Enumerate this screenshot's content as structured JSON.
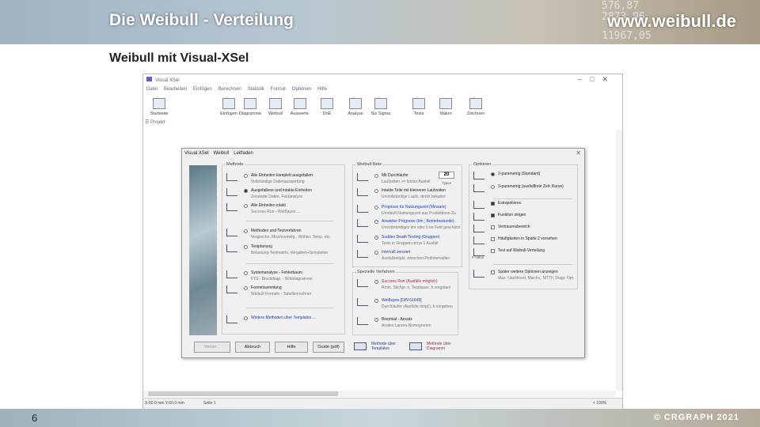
{
  "slide": {
    "title": "Die Weibull - Verteilung",
    "url": "www.weibull.de",
    "bg_numbers": [
      "576,87",
      "2873,96",
      "11967,05"
    ],
    "subtitle": "Weibull mit Visual-XSel",
    "page_number": "6",
    "copyright": "© CRGRAPH 2021"
  },
  "app": {
    "title": "Visual XSel",
    "menu": [
      "Datei",
      "Bearbeiten",
      "Einfügen",
      "Berechnen",
      "Statistik",
      "Format",
      "Optionen",
      "Hilfe"
    ],
    "toolbar": [
      "Startseite",
      "Einfügen",
      "Diagramme",
      "Weibull",
      "Auswerte.",
      "DoE",
      "Analyse",
      "Six Sigma",
      "Tests",
      "Makro",
      "Zeichnen"
    ],
    "project_label": "Projekt",
    "status": {
      "coords": "X-60.0 mm  Y-60.0 mm",
      "sheet": "Seite 1",
      "zoom": "+ 100%"
    }
  },
  "dialog": {
    "menu": [
      "Visual XSel",
      "Weibull",
      "Leitfaden"
    ],
    "methode": {
      "label": "Methode",
      "items": [
        {
          "l1": "Alle Einheiten komplett ausgefallen",
          "l2": "Vollständige Datenauswertung",
          "selected": false
        },
        {
          "l1": "Ausgefallene und intakte Einheiten",
          "l2": "Zensierte Daten, Feldanalyse",
          "selected": true
        },
        {
          "l1": "Alle Einheiten intakt",
          "l2": "Success Run - WeiBayes ...",
          "selected": false
        },
        {
          "l1": "Methoden und Testverfahren",
          "l2": "Vergleiche, Mischverteilg., Wöhler, Temp. etc.",
          "selected": false
        },
        {
          "l1": "Testplanung",
          "l2": "Belastung-Testmatrix, Vorgaben+Simulation",
          "selected": false
        },
        {
          "l1": "Systemanalyse - Fehlerbaum",
          "l2": "FTS - Blockdiagr. - Wirkdiagramme",
          "selected": false
        },
        {
          "l1": "Formelsammlung",
          "l2": "Weibull-Formeln - Tabellenrechner",
          "selected": false
        },
        {
          "l1": "Weitere Methoden über Templates ...",
          "l2": "",
          "selected": false
        }
      ]
    },
    "netz": {
      "label": "Weibull-Netz",
      "count": "20",
      "count_unit": "Typen",
      "items": [
        {
          "l1": "Mit Durchläufer",
          "l2": "Laufzeiten >= letzter Ausfall"
        },
        {
          "l1": "Intakte Teile mit kleineren Laufzeiten",
          "l2": "Unvollständige Laufz. direkt bekannt"
        },
        {
          "l1": "Prognose für Nutzungszeit (Minsare)",
          "l2": "Umrläuft Nutzungszeit aus Produktions-Zu"
        },
        {
          "l1": "Anwärter Prognose (km ; Betriebsstunde)",
          "l2": "Unvollständiges km oder h im Feld geschätzt"
        },
        {
          "l1": "Sudden Death Testing (Gruppen)",
          "l2": "Tests in Gruppen mit je 1 Ausfall"
        },
        {
          "l1": "Intervall zensiert",
          "l2": "Ausfallzeitpkt. zwischen Prüfintervallen"
        }
      ]
    },
    "spezial": {
      "label": "Spezielle Verfahren",
      "items": [
        {
          "l1": "Success Run        (Ausfälle möglich)",
          "l2": "Rmin, Stichpr. n, Testdauer, b vorgeben"
        },
        {
          "l1": "WeiBayes [DIN 61649]",
          "l2": "Durchläufer (Ausfälle mögl.), b vorgeben"
        },
        {
          "l1": "Binomial - Ansatz",
          "l2": "Anales Larsen-Nomogramm"
        }
      ]
    },
    "optionen": {
      "label": "Optionen",
      "items": [
        {
          "l1": "2-parametrig  (Standard)",
          "type": "radio",
          "on": true
        },
        {
          "l1": "3-parametrig  (ausfallfreie Zeit: Kurve)",
          "type": "radio",
          "on": false
        },
        {
          "l1": "Extrapolieren",
          "type": "check",
          "on": true
        },
        {
          "l1": "Funktion zeigen",
          "type": "check",
          "on": true
        },
        {
          "l1": "Vertrauensbereich",
          "type": "check",
          "on": false
        },
        {
          "l1": "Häufigkeiten in Spalte 2 vorsehen",
          "type": "check",
          "on": false
        },
        {
          "l1": "Test auf Weibull-Verteilung",
          "type": "check",
          "on": false
        },
        {
          "l1": "Später weitere Optionen anzeigen",
          "l2": "Max. Likelihood, Mischv., MTTF, Diagr. Opt.",
          "type": "check",
          "on": false
        }
      ],
      "p_value_label": "P-value"
    },
    "buttons": [
      "Weiter...",
      "Abbruch",
      "Hilfe",
      "Guide (pdf)"
    ],
    "links": [
      "Methode über Templates",
      "Methode über Diagramm"
    ]
  }
}
